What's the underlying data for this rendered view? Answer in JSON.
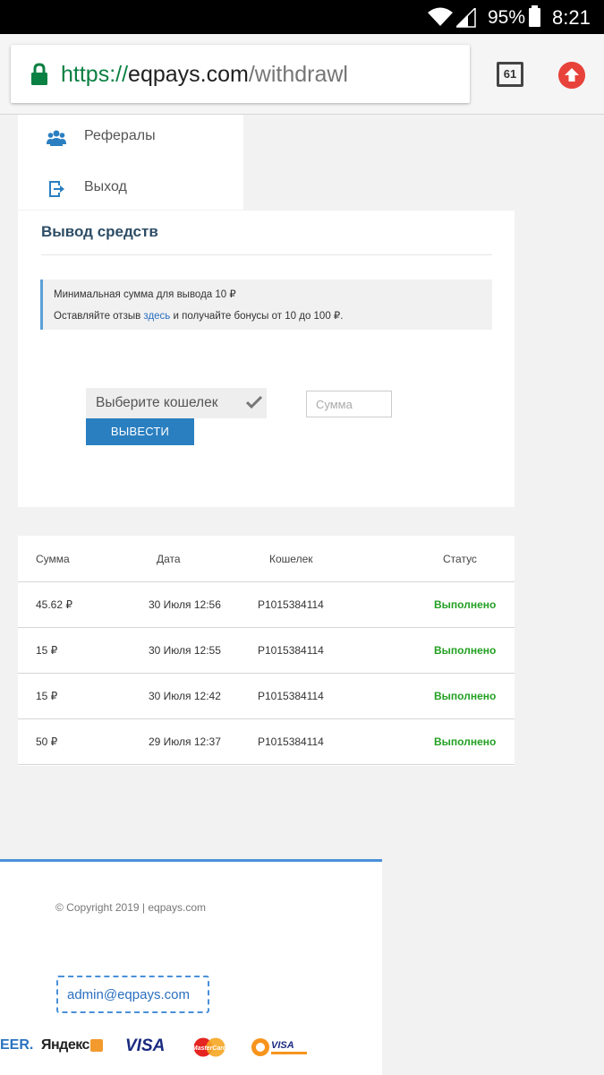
{
  "status_bar": {
    "battery": "95%",
    "time": "8:21"
  },
  "browser": {
    "url_scheme": "https://",
    "url_host": "eqpays.com",
    "url_path": "/withdrawl",
    "tab_count": "61"
  },
  "menu": {
    "items": [
      {
        "label": "Рефералы",
        "icon": "users-icon"
      },
      {
        "label": "Выход",
        "icon": "logout-icon"
      }
    ]
  },
  "withdraw": {
    "title": "Вывод средств",
    "info_min": "Минимальная сумма для вывода 10 ₽",
    "info_review_prefix": "Оставляйте отзыв ",
    "info_review_link": "здесь",
    "info_review_suffix": " и получайте бонусы от 10 до 100 ₽.",
    "wallet_select": "Выберите кошелек",
    "amount_placeholder": "Сумма",
    "button": "ВЫВЕСТИ"
  },
  "history": {
    "headers": {
      "amount": "Сумма",
      "date": "Дата",
      "wallet": "Кошелек",
      "status": "Статус"
    },
    "rows": [
      {
        "amount": "45.62 ₽",
        "date": "30 Июля 12:56",
        "wallet": "P1015384114",
        "status": "Выполнено"
      },
      {
        "amount": "15 ₽",
        "date": "30 Июля 12:55",
        "wallet": "P1015384114",
        "status": "Выполнено"
      },
      {
        "amount": "15 ₽",
        "date": "30 Июля 12:42",
        "wallet": "P1015384114",
        "status": "Выполнено"
      },
      {
        "amount": "50 ₽",
        "date": "29 Июля 12:37",
        "wallet": "P1015384114",
        "status": "Выполнено"
      }
    ]
  },
  "footer": {
    "copyright": "© Copyright 2019 | eqpays.com",
    "email": "admin@eqpays.com",
    "logos": {
      "payeer": "EER.",
      "yandex": "Яндекс",
      "visa": "VISA",
      "mastercard": "MasterCard",
      "qiwi": "VISA"
    }
  },
  "colors": {
    "accent": "#2a7fc0",
    "status_ok": "#22a022",
    "url_green": "#0b8043"
  }
}
